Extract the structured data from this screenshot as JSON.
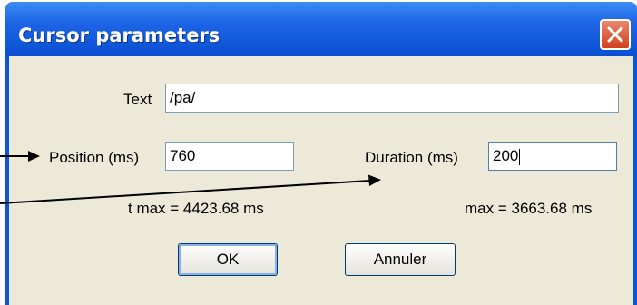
{
  "dialog": {
    "title": "Cursor parameters",
    "close_icon": "close-icon"
  },
  "fields": {
    "text_label": "Text",
    "text_value": "/pa/",
    "position_label": "Position (ms)",
    "position_value": "760",
    "duration_label": "Duration (ms)",
    "duration_value": "200",
    "t_max": "t max = 4423.68 ms",
    "max": "max = 3663.68 ms"
  },
  "buttons": {
    "ok": "OK",
    "cancel": "Annuler"
  },
  "colors": {
    "titlebar": "#0a4fd3",
    "client": "#ece9d8",
    "close": "#d1401f"
  }
}
